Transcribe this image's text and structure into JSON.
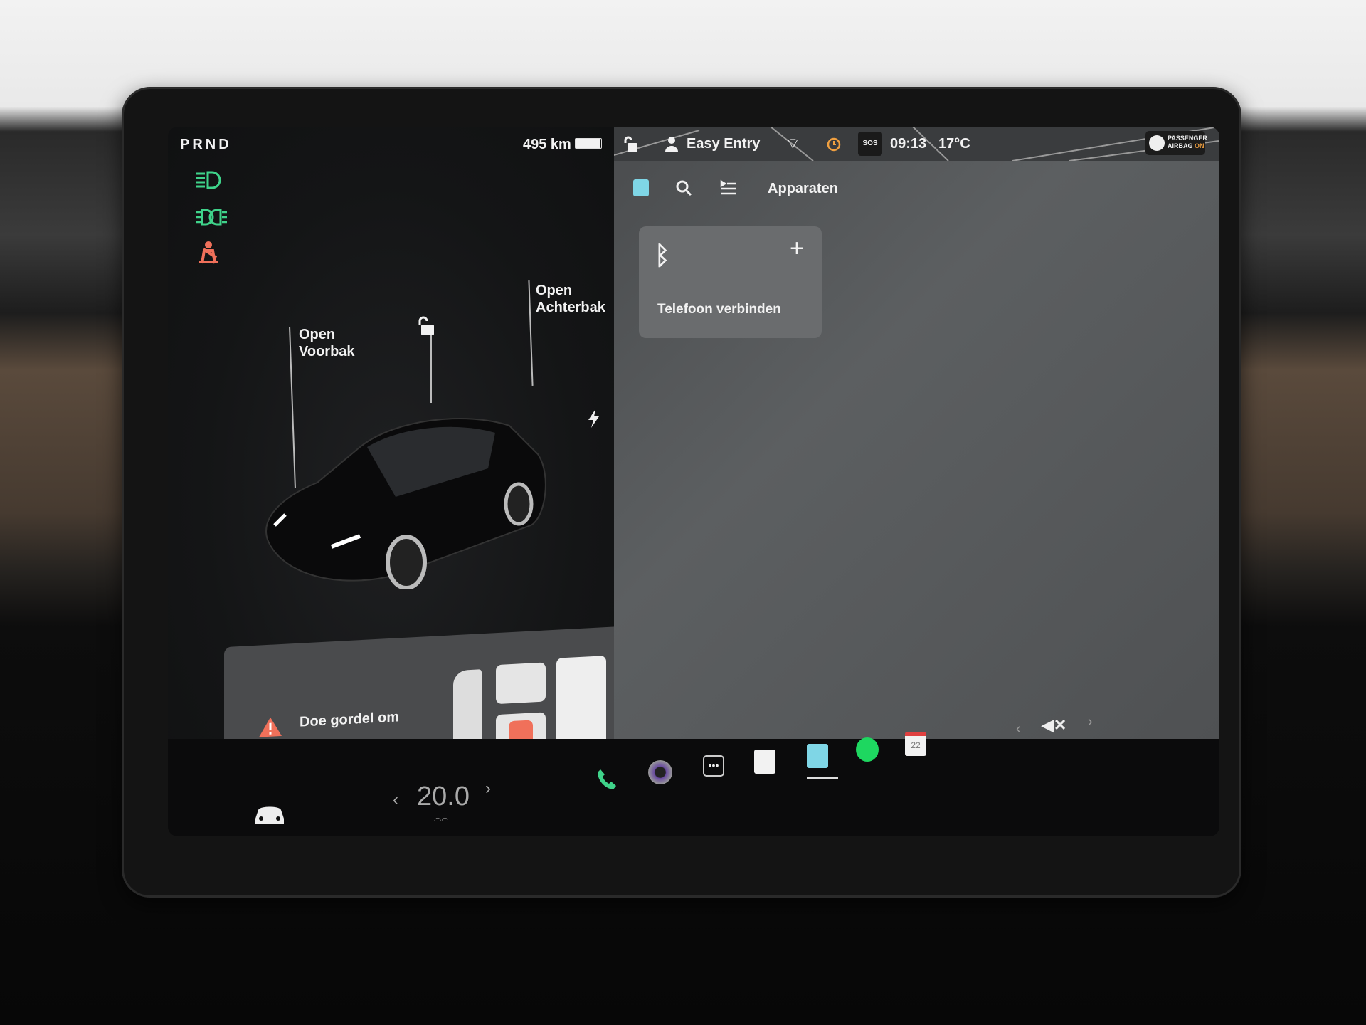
{
  "status": {
    "gear": "PRND",
    "range": "495 km",
    "battery_percent": 95
  },
  "indicators": [
    {
      "icon": "low-beam-headlight-icon",
      "color": "#3fd38a"
    },
    {
      "icon": "fog-light-icon",
      "color": "#3fd38a"
    },
    {
      "icon": "seatbelt-warning-icon",
      "color": "#f0705a"
    }
  ],
  "car": {
    "frunk_label_1": "Open",
    "frunk_label_2": "Voorbak",
    "trunk_label_1": "Open",
    "trunk_label_2": "Achterbak",
    "lock_icon": "unlock-icon",
    "charge_icon": "lightning-icon"
  },
  "alert": {
    "text": "Doe gordel om",
    "icon": "warning-triangle-icon",
    "color": "#f0705a"
  },
  "topbar": {
    "profile": "Easy Entry",
    "sos": "SOS",
    "time": "09:13",
    "temperature": "17°C",
    "airbag_line1": "PASSENGER",
    "airbag_line2": "AIRBAG",
    "airbag_state": "ON"
  },
  "toolbar": {
    "title": "Apparaten"
  },
  "bluetooth_card": {
    "label": "Telefoon verbinden",
    "plus": "+"
  },
  "climate": {
    "temperature": "20.0"
  },
  "dock": {
    "calendar_day": "22",
    "apps": [
      "phone",
      "camera",
      "more",
      "notes",
      "bluetooth",
      "spotify",
      "calendar"
    ],
    "active": "bluetooth"
  },
  "accent_colors": {
    "green": "#3fd38a",
    "red": "#f0705a",
    "bluetooth": "#7fd6e6",
    "spotify": "#1ed760"
  }
}
